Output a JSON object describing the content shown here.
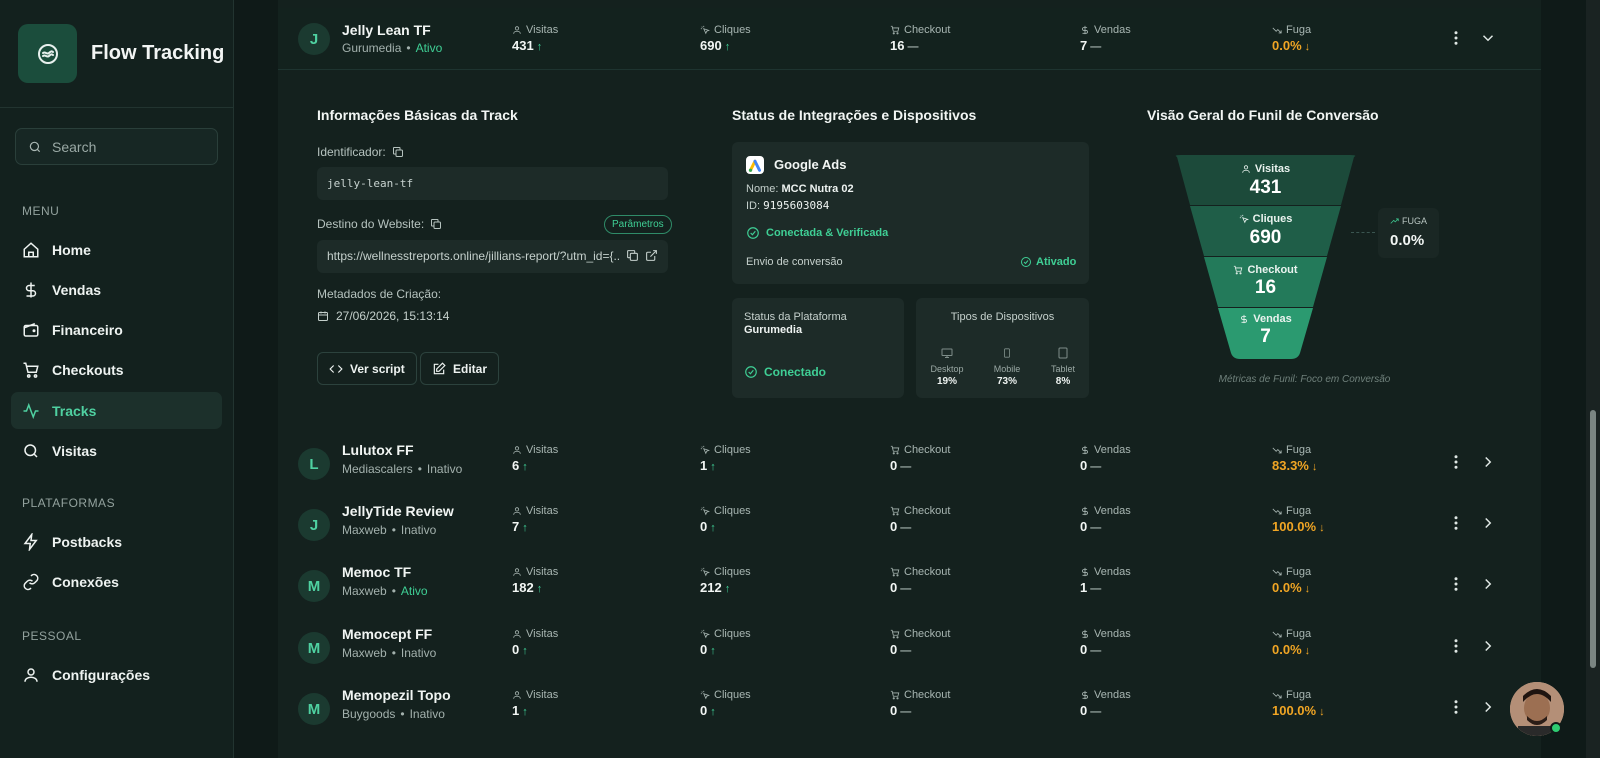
{
  "app": {
    "name": "Flow Tracking"
  },
  "search": {
    "placeholder": "Search"
  },
  "sections": {
    "menu": "MENU",
    "plataformas": "PLATAFORMAS",
    "pessoal": "PESSOAL"
  },
  "nav": {
    "home": "Home",
    "vendas": "Vendas",
    "financeiro": "Financeiro",
    "checkouts": "Checkouts",
    "tracks": "Tracks",
    "visitas": "Visitas",
    "postbacks": "Postbacks",
    "conexoes": "Conexões",
    "configuracoes": "Configurações"
  },
  "metric_labels": {
    "visitas": "Visitas",
    "cliques": "Cliques",
    "checkout": "Checkout",
    "vendas": "Vendas",
    "fuga": "Fuga"
  },
  "tracks": [
    {
      "initial": "J",
      "name": "Jelly Lean TF",
      "platform": "Gurumedia",
      "status": "Ativo",
      "active": true,
      "visitas": "431",
      "cliques": "690",
      "checkout": "16",
      "vendas": "7",
      "fuga": "0.0%"
    },
    {
      "initial": "L",
      "name": "Lulutox FF",
      "platform": "Mediascalers",
      "status": "Inativo",
      "active": false,
      "visitas": "6",
      "cliques": "1",
      "checkout": "0",
      "vendas": "0",
      "fuga": "83.3%"
    },
    {
      "initial": "J",
      "name": "JellyTide Review",
      "platform": "Maxweb",
      "status": "Inativo",
      "active": false,
      "visitas": "7",
      "cliques": "0",
      "checkout": "0",
      "vendas": "0",
      "fuga": "100.0%"
    },
    {
      "initial": "M",
      "name": "Memoc TF",
      "platform": "Maxweb",
      "status": "Ativo",
      "active": true,
      "visitas": "182",
      "cliques": "212",
      "checkout": "0",
      "vendas": "1",
      "fuga": "0.0%"
    },
    {
      "initial": "M",
      "name": "Memocept FF",
      "platform": "Maxweb",
      "status": "Inativo",
      "active": false,
      "visitas": "0",
      "cliques": "0",
      "checkout": "0",
      "vendas": "0",
      "fuga": "0.0%"
    },
    {
      "initial": "M",
      "name": "Memopezil Topo",
      "platform": "Buygoods",
      "status": "Inativo",
      "active": false,
      "visitas": "1",
      "cliques": "0",
      "checkout": "0",
      "vendas": "0",
      "fuga": "100.0%"
    }
  ],
  "details": {
    "info_title": "Informações Básicas da Track",
    "identificador_label": "Identificador:",
    "identificador_value": "jelly-lean-tf",
    "destino_label": "Destino do Website:",
    "parametros": "Parâmetros",
    "destino_value": "https://wellnesstreports.online/jillians-report/?utm_id={...",
    "metadados_label": "Metadados de Criação:",
    "created_at": "27/06/2026, 15:13:14",
    "ver_script": "Ver script",
    "editar": "Editar",
    "status_title": "Status de Integrações e Dispositivos",
    "google_ads": "Google Ads",
    "nome_label": "Nome:",
    "nome_value": "MCC Nutra 02",
    "id_label": "ID:",
    "id_value": "9195603084",
    "conectada": "Conectada & Verificada",
    "envio": "Envio de conversão",
    "ativado": "Ativado",
    "status_plataforma": "Status da Plataforma",
    "plataforma": "Gurumedia",
    "conectado": "Conectado",
    "tipos_dispositivos": "Tipos de Dispositivos",
    "devices": [
      {
        "name": "Desktop",
        "pct": "19%"
      },
      {
        "name": "Mobile",
        "pct": "73%"
      },
      {
        "name": "Tablet",
        "pct": "8%"
      }
    ],
    "funnel_title": "Visão Geral do Funil de Conversão",
    "funnel": [
      {
        "label": "Visitas",
        "value": "431"
      },
      {
        "label": "Cliques",
        "value": "690"
      },
      {
        "label": "Checkout",
        "value": "16"
      },
      {
        "label": "Vendas",
        "value": "7"
      }
    ],
    "fuga_label": "FUGA",
    "fuga_value": "0.0%",
    "funnel_caption": "Métricas de Funil: Foco em Conversão"
  },
  "colors": {
    "accent": "#3fcf95",
    "warning": "#f0a524",
    "background": "#0f1a18"
  }
}
